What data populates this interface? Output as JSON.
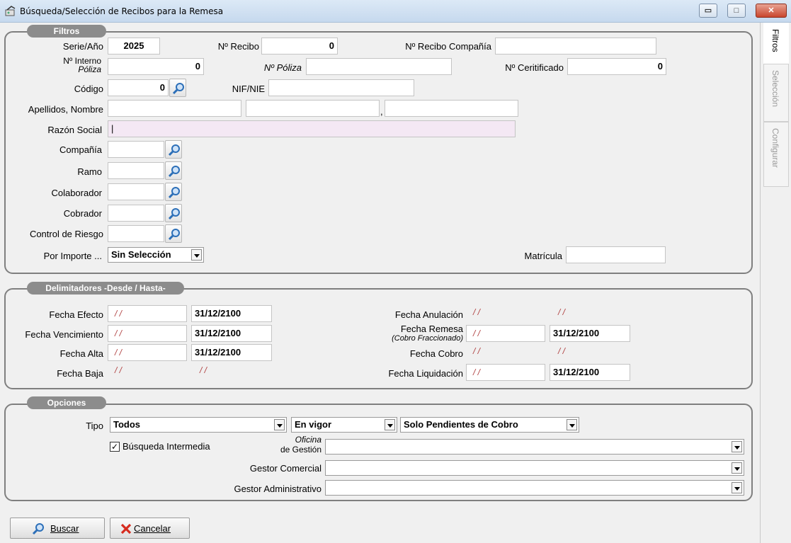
{
  "window": {
    "title": "Búsqueda/Selección de Recibos para la Remesa",
    "min": "▭",
    "max": "□",
    "close": "✕"
  },
  "side_tabs": [
    "Filtros",
    "Selección",
    "Configurar"
  ],
  "filtros": {
    "title": "Filtros",
    "serie_label": "Serie/Año",
    "serie_value": "2025",
    "nrecibo_label": "Nº Recibo",
    "nrecibo_value": "0",
    "nrecibo_comp_label": "Nº Recibo Compañía",
    "nrecibo_comp_value": "",
    "ninterno_label": "Nº Interno",
    "poliza_sub": "Póliza",
    "ninterno_value": "0",
    "npoliza_label": "Nº Póliza",
    "npoliza_value": "",
    "ncert_label": "Nº Ceritificado",
    "ncert_value": "0",
    "codigo_label": "Código",
    "codigo_value": "0",
    "nif_label": "NIF/NIE",
    "nif_value": "",
    "apellidos_label": "Apellidos, Nombre",
    "comma": ",",
    "razon_label": "Razón Social",
    "razon_value": "|",
    "compania_label": "Compañía",
    "ramo_label": "Ramo",
    "colaborador_label": "Colaborador",
    "cobrador_label": "Cobrador",
    "control_label": "Control de Riesgo",
    "importe_label": "Por Importe ...",
    "importe_value": "Sin Selección",
    "matricula_label": "Matrícula",
    "matricula_value": ""
  },
  "delimitadores": {
    "title": "Delimitadores -Desde / Hasta-",
    "empty_date": "/ /",
    "efecto_label": "Fecha Efecto",
    "efecto_hasta": "31/12/2100",
    "venc_label": "Fecha Vencimiento",
    "venc_hasta": "31/12/2100",
    "alta_label": "Fecha Alta",
    "alta_hasta": "31/12/2100",
    "baja_label": "Fecha Baja",
    "anulacion_label": "Fecha Anulación",
    "remesa_label": "Fecha Remesa",
    "remesa_sub": "(Cobro Fraccionado)",
    "remesa_hasta": "31/12/2100",
    "cobro_label": "Fecha Cobro",
    "liquidacion_label": "Fecha Liquidación",
    "liquidacion_hasta": "31/12/2100"
  },
  "opciones": {
    "title": "Opciones",
    "tipo_label": "Tipo",
    "tipo_value": "Todos",
    "vigor_value": "En vigor",
    "pendientes_value": "Solo Pendientes de Cobro",
    "busqueda_label": "Búsqueda Intermedia",
    "check": "✓",
    "oficina_label1": "Oficina",
    "oficina_label2": "de Gestión",
    "gestor_com_label": "Gestor Comercial",
    "gestor_adm_label": "Gestor Administrativo"
  },
  "buttons": {
    "buscar": "Buscar",
    "cancelar": "Cancelar"
  },
  "colors": {
    "group_title_bg": "#8c8c8c",
    "date_red": "#b04040",
    "pink_field": "#f4e8f4"
  }
}
